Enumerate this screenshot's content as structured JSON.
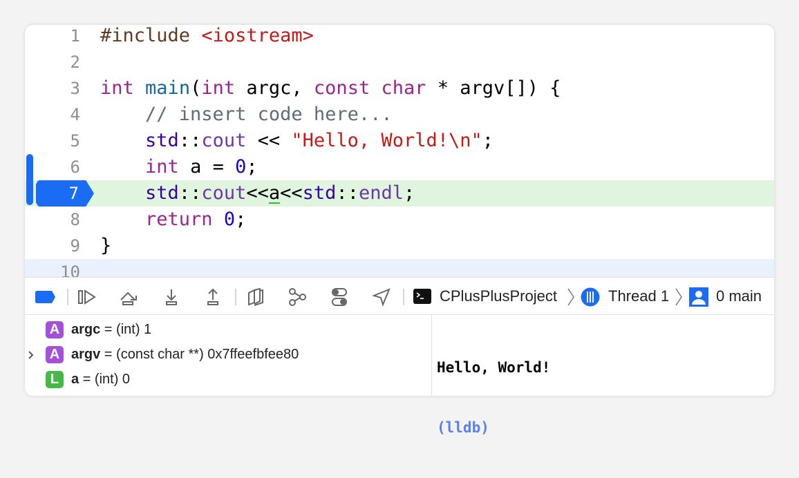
{
  "editor": {
    "current_line": 7,
    "lines": [
      {
        "n": "1",
        "tokens": [
          [
            "#include ",
            "pp"
          ],
          [
            "<iostream>",
            "str"
          ]
        ]
      },
      {
        "n": "2",
        "tokens": []
      },
      {
        "n": "3",
        "tokens": [
          [
            "int",
            "kw"
          ],
          [
            " ",
            ""
          ],
          [
            "main",
            "fn"
          ],
          [
            "(",
            ""
          ],
          [
            "int",
            "kw"
          ],
          [
            " argc, ",
            ""
          ],
          [
            "const",
            "kw"
          ],
          [
            " ",
            ""
          ],
          [
            "char",
            "kw"
          ],
          [
            " * argv[]) {",
            ""
          ]
        ]
      },
      {
        "n": "4",
        "tokens": [
          [
            "    // insert code here...",
            "cm"
          ]
        ]
      },
      {
        "n": "5",
        "tokens": [
          [
            "    ",
            ""
          ],
          [
            "std",
            "cls"
          ],
          [
            "::",
            ""
          ],
          [
            "cout",
            "oth"
          ],
          [
            " << ",
            ""
          ],
          [
            "\"Hello, World!\\n\"",
            "str"
          ],
          [
            ";",
            ""
          ]
        ]
      },
      {
        "n": "6",
        "tokens": [
          [
            "    ",
            ""
          ],
          [
            "int",
            "kw"
          ],
          [
            " a = ",
            ""
          ],
          [
            "0",
            "num"
          ],
          [
            ";",
            ""
          ]
        ]
      },
      {
        "n": "7",
        "tokens": [
          [
            "    ",
            ""
          ],
          [
            "std",
            "cls"
          ],
          [
            "::",
            ""
          ],
          [
            "cout",
            "oth"
          ],
          [
            "<<",
            ""
          ],
          [
            "a",
            "var"
          ],
          [
            "<<",
            ""
          ],
          [
            "std",
            "cls"
          ],
          [
            "::",
            ""
          ],
          [
            "endl",
            "oth"
          ],
          [
            ";",
            ""
          ]
        ]
      },
      {
        "n": "8",
        "tokens": [
          [
            "    ",
            ""
          ],
          [
            "return",
            "kw"
          ],
          [
            " ",
            ""
          ],
          [
            "0",
            "num"
          ],
          [
            ";",
            ""
          ]
        ]
      },
      {
        "n": "9",
        "tokens": [
          [
            "}",
            ""
          ]
        ]
      },
      {
        "n": "10",
        "tokens": []
      }
    ]
  },
  "debug_bar": {
    "icons": [
      "breakpoints-toggle-icon",
      "continue-icon",
      "step-over-icon",
      "step-into-icon",
      "step-out-icon",
      "view-hierarchy-icon",
      "memory-graph-icon",
      "environment-overrides-icon",
      "simulate-location-icon"
    ],
    "breadcrumb": {
      "target": "CPlusPlusProject",
      "thread": "Thread 1",
      "frame": "0 main"
    },
    "accent": "#1a6cf5"
  },
  "variables": [
    {
      "badge": "A",
      "badge_color": "#a550d8",
      "name": "argc",
      "rest": " = (int) 1",
      "expandable": false
    },
    {
      "badge": "A",
      "badge_color": "#a550d8",
      "name": "argv",
      "rest": " = (const char **) 0x7ffeefbfee80",
      "expandable": true
    },
    {
      "badge": "L",
      "badge_color": "#45b84a",
      "name": "a",
      "rest": " = (int) 0",
      "expandable": false
    }
  ],
  "console": {
    "output": "Hello, World!",
    "prompt": "(lldb)"
  }
}
